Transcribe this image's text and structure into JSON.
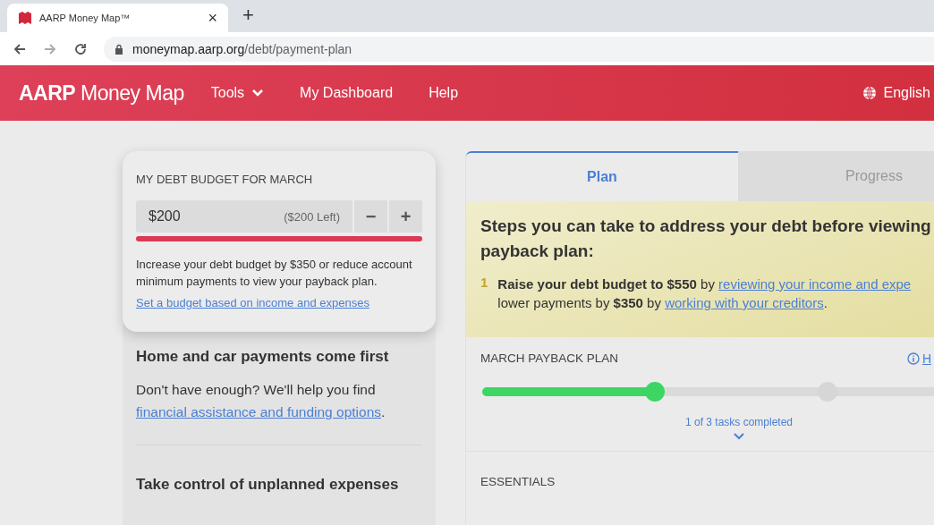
{
  "browser": {
    "tab_title": "AARP Money Map™",
    "close": "×",
    "new_tab": "+",
    "url_host": "moneymap.aarp.org",
    "url_path": "/debt/payment-plan"
  },
  "nav": {
    "logo_bold": "AARP",
    "logo_rest": "Money Map",
    "items": [
      {
        "label": "Tools",
        "kind": "dropdown"
      },
      {
        "label": "My Dashboard",
        "kind": "link"
      },
      {
        "label": "Help",
        "kind": "link"
      }
    ],
    "language": "English"
  },
  "budget_card": {
    "title": "MY DEBT BUDGET FOR MARCH",
    "value": "$200",
    "left": "($200 Left)",
    "minus": "−",
    "plus": "+",
    "message": "Increase your debt budget by $350 or reduce account minimum payments to view your payback plan.",
    "link": "Set a budget based on income and expenses"
  },
  "sections": [
    {
      "heading": "Home and car payments come first",
      "text": "Don't have enough? We'll help you find ",
      "link": "financial assistance and funding options",
      "suffix": "."
    },
    {
      "heading": "Take control of unplanned expenses"
    }
  ],
  "tabs": [
    {
      "label": "Plan",
      "selected": true
    },
    {
      "label": "Progress",
      "selected": false
    }
  ],
  "steps_box": {
    "heading_lines": [
      "Steps you can take to address your debt before viewing",
      "payback plan:"
    ],
    "steps": [
      {
        "number": "1",
        "line1": "**Raise your debt budget to $550** by ",
        "link1": "reviewing your income and expe",
        "line2": "lower payments by **$350** by ",
        "link2": "working with your creditors",
        "suffix": "."
      }
    ]
  },
  "payback": {
    "title": "MARCH PAYBACK PLAN",
    "help_link": "H",
    "level": 0.333,
    "status": "1 of 3 tasks completed"
  },
  "essentials": {
    "title": "ESSENTIALS"
  }
}
